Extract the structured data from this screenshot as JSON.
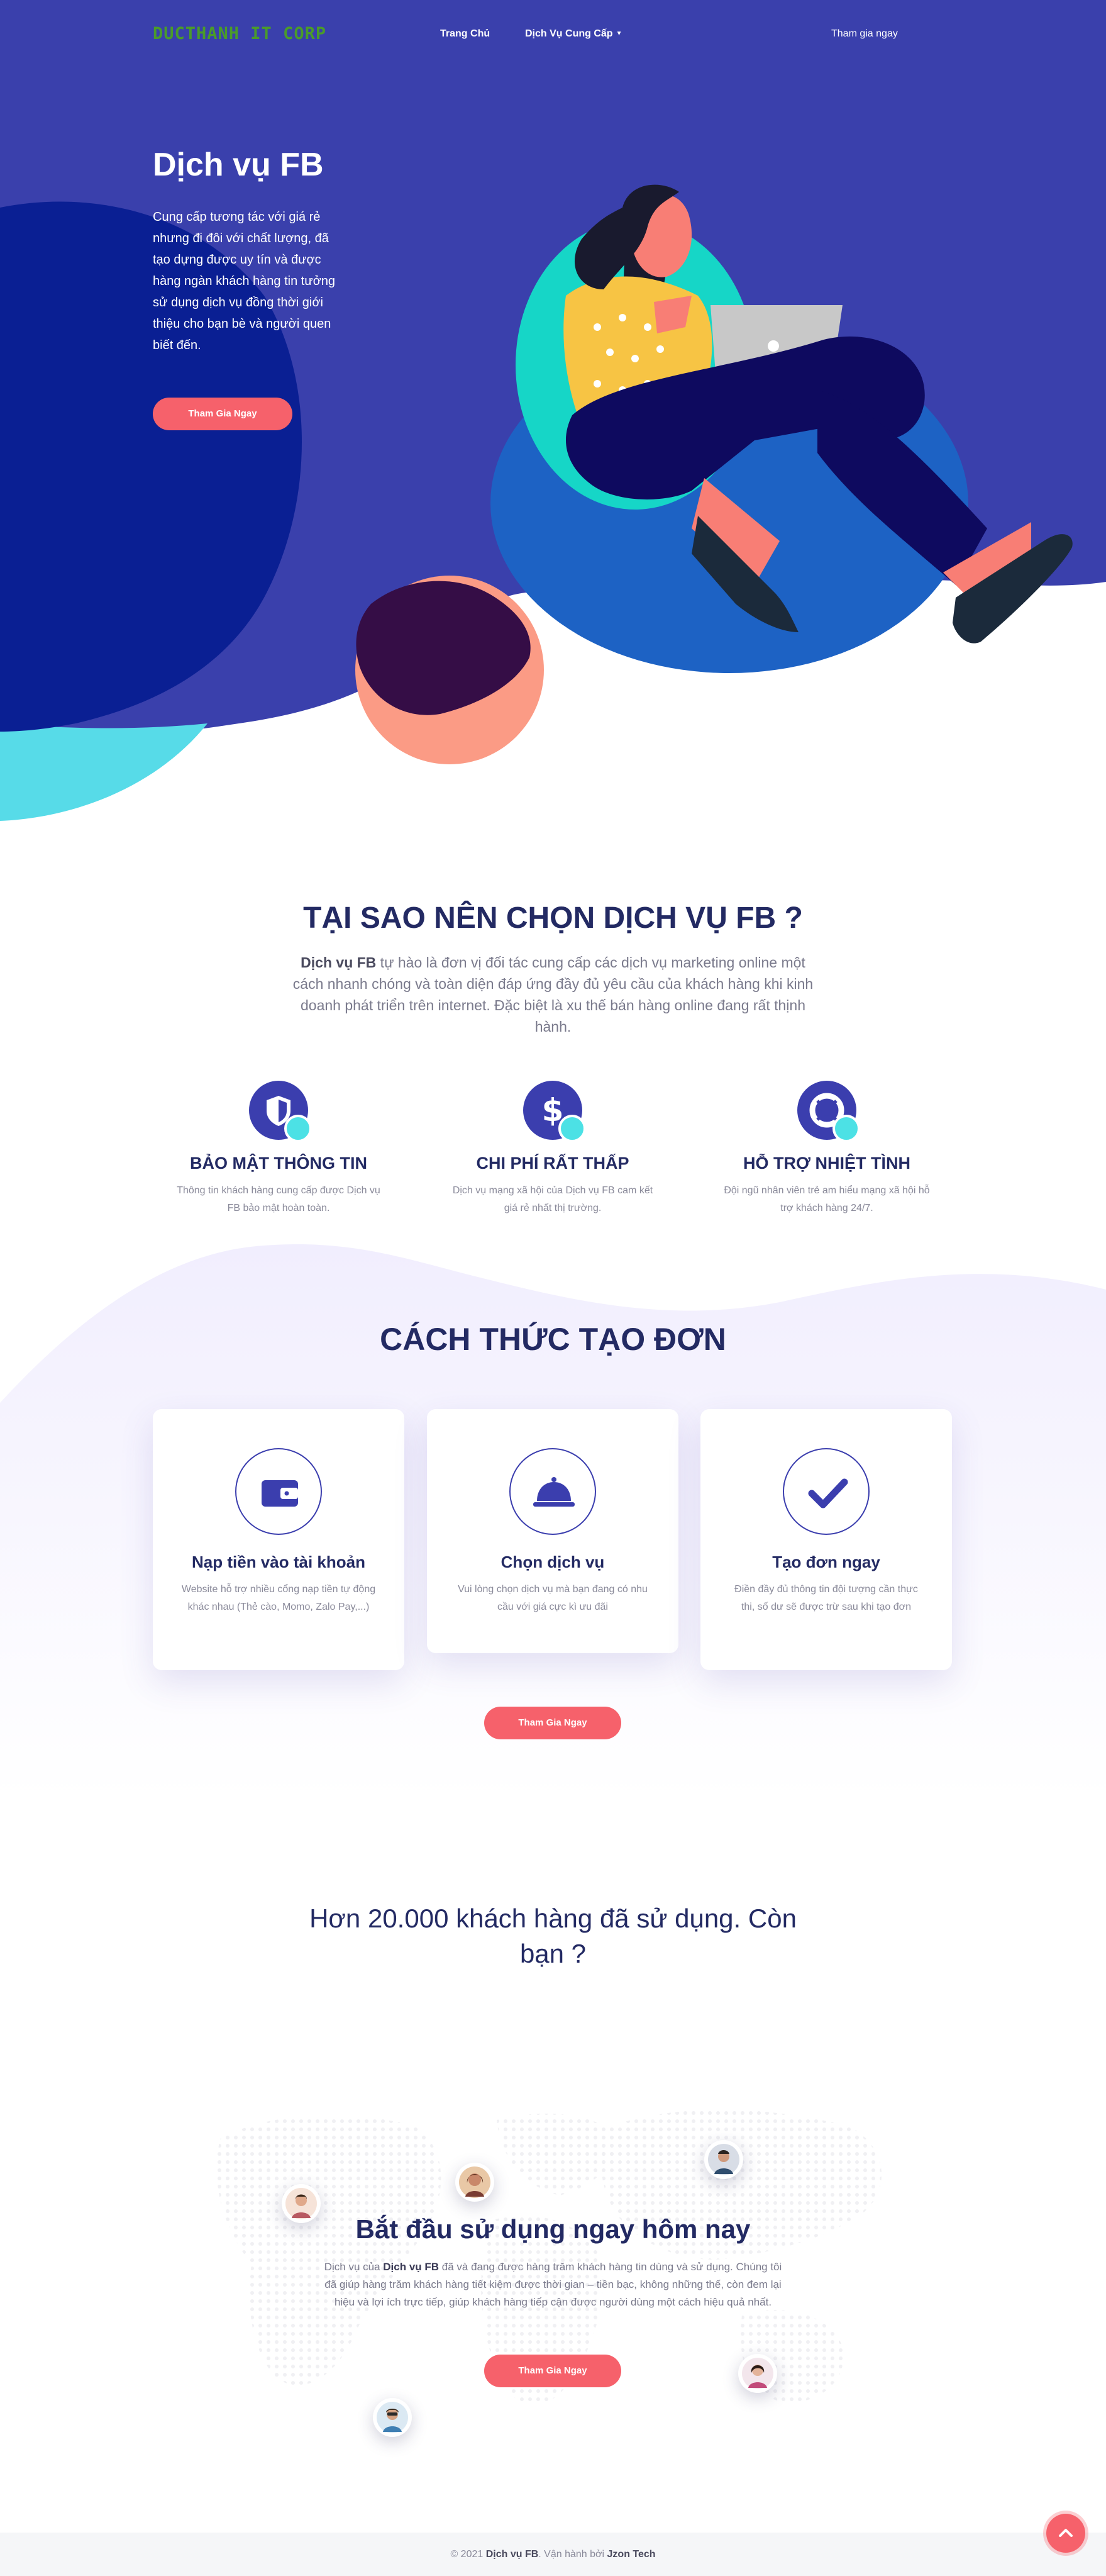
{
  "nav": {
    "logo": "DUCTHANH IT CORP",
    "home": "Trang Chủ",
    "services": "Dịch Vụ Cung Cấp",
    "join": "Tham gia ngay"
  },
  "hero": {
    "title": "Dịch vụ FB",
    "description": "Cung cấp tương tác với giá rẻ nhưng đi đôi với chất lượng, đã tạo dựng được uy tín và được hàng ngàn khách hàng tin tưởng sử dụng dịch vụ đồng thời giới thiệu cho bạn bè và người quen biết đến.",
    "button": "Tham Gia Ngay"
  },
  "why": {
    "title": "TẠI SAO NÊN CHỌN DỊCH VỤ FB ?",
    "desc_bold": "Dịch vụ FB",
    "desc_rest": " tự hào là đơn vị đối tác cung cấp các dịch vụ marketing online một cách nhanh chóng và toàn diện đáp ứng đầy đủ yêu cầu của khách hàng khi kinh doanh phát triển trên internet. Đặc biệt là xu thế bán hàng online đang rất thịnh hành.",
    "features": [
      {
        "icon": "shield-icon",
        "title": "BẢO MẬT THÔNG TIN",
        "text": "Thông tin khách hàng cung cấp được Dịch vụ FB bảo mật hoàn toàn."
      },
      {
        "icon": "dollar-icon",
        "title": "CHI PHÍ RẤT THẤP",
        "text": "Dịch vụ mạng xã hội của Dịch vụ FB cam kết giá rẻ nhất thị trường."
      },
      {
        "icon": "lifebuoy-icon",
        "title": "HỖ TRỢ NHIỆT TÌNH",
        "text": "Đội ngũ nhân viên trẻ am hiểu mạng xã hội hỗ trợ khách hàng 24/7."
      }
    ]
  },
  "how": {
    "title": "CÁCH THỨC TẠO ĐƠN",
    "steps": [
      {
        "icon": "wallet-icon",
        "title": "Nạp tiền vào tài khoản",
        "text": "Website hỗ trợ nhiều cổng nạp tiền tự động khác nhau (Thẻ cào, Momo, Zalo Pay,...)"
      },
      {
        "icon": "service-bell-icon",
        "title": "Chọn dịch vụ",
        "text": "Vui lòng chọn dịch vụ mà bạn đang có nhu cầu với giá cực kì ưu đãi"
      },
      {
        "icon": "check-icon",
        "title": "Tạo đơn ngay",
        "text": "Điền đầy đủ thông tin đội tượng cần thực thi, số dư sẽ được trừ sau khi tạo đơn"
      }
    ],
    "button": "Tham Gia Ngay"
  },
  "count": {
    "text": "Hơn 20.000 khách hàng đã sử dụng. Còn bạn ?"
  },
  "start": {
    "title": "Bắt đầu sử dụng ngay hôm nay",
    "desc_pre": "Dịch vụ của ",
    "desc_bold": "Dịch vụ FB",
    "desc_rest": " đã và đang được hàng trăm khách hàng tin dùng và sử dụng. Chúng tôi đã giúp hàng trăm khách hàng tiết kiệm được thời gian – tiền bạc, không những thế, còn đem lại hiệu và lợi ích trực tiếp, giúp khách hàng tiếp cận được người dùng một cách hiệu quả nhất.",
    "button": "Tham Gia Ngay"
  },
  "footer": {
    "prefix": "© 2021 ",
    "brand": "Dịch vụ FB",
    "middle": ". Vận hành bởi ",
    "operator": "Jzon Tech"
  },
  "colors": {
    "hero_bg": "#3a40ac",
    "accent": "#f6616b",
    "heading": "#232a63",
    "cyan": "#4ce1e5",
    "logo": "#4a9b2a"
  },
  "scroll_top_icon": "chevron-up-icon"
}
